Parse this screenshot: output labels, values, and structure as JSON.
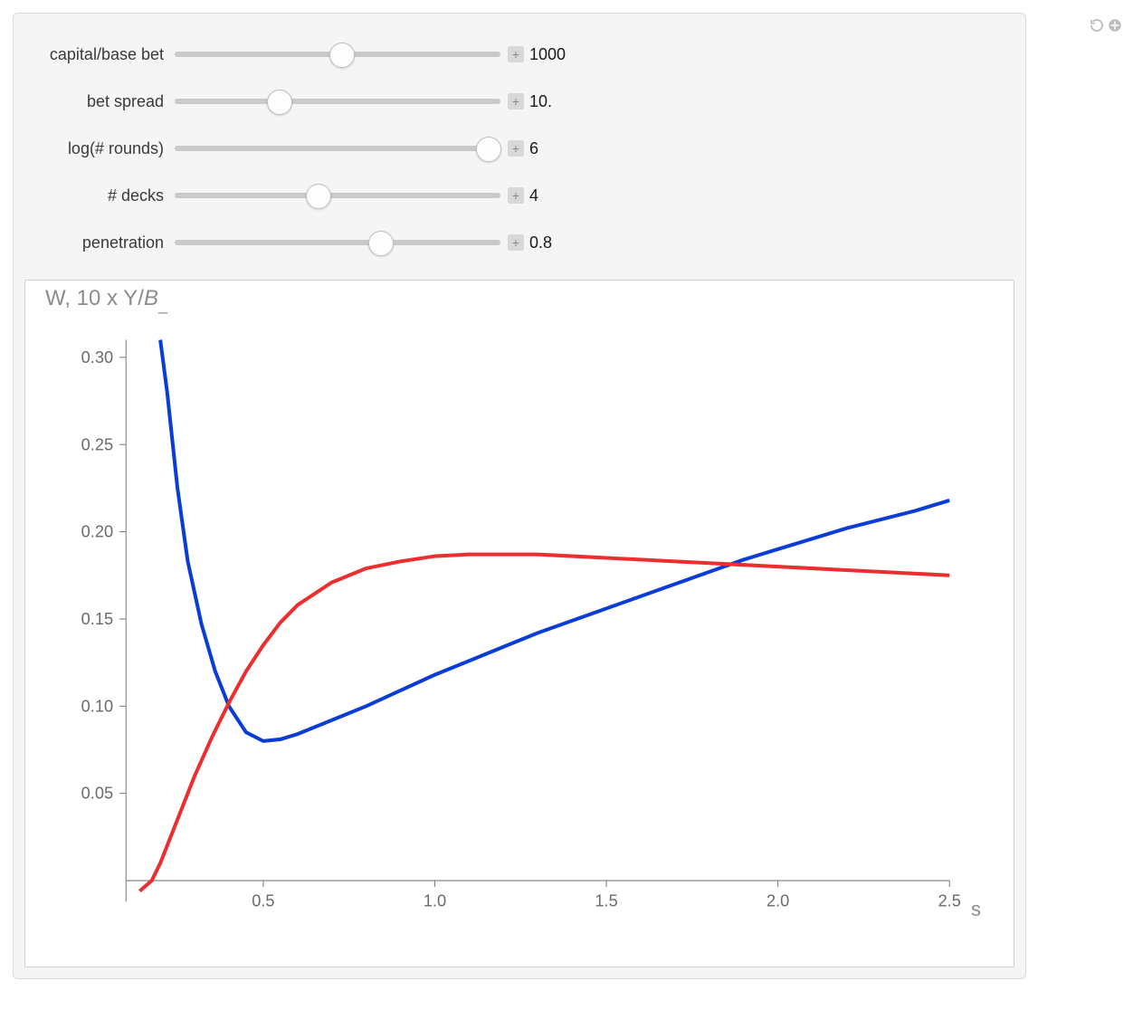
{
  "controls": [
    {
      "id": "capital",
      "label": "capital/base bet",
      "value": "1000",
      "pos": 0.51
    },
    {
      "id": "spread",
      "label": "bet spread",
      "value": "10.",
      "pos": 0.32
    },
    {
      "id": "logrounds",
      "label": "log(# rounds)",
      "value": "6",
      "pos": 0.96
    },
    {
      "id": "decks",
      "label": "# decks",
      "value": "4",
      "pos": 0.44
    },
    {
      "id": "penetration",
      "label": "penetration",
      "value": "0.8",
      "pos": 0.63
    }
  ],
  "chart_data": {
    "type": "line",
    "title": "",
    "ylabel_plain": "W, 10 x Y/B_",
    "xlabel": "s",
    "xlim": [
      0.1,
      2.5
    ],
    "ylim": [
      -0.01,
      0.31
    ],
    "xticks": [
      0.5,
      1.0,
      1.5,
      2.0,
      2.5
    ],
    "yticks": [
      0.05,
      0.1,
      0.15,
      0.2,
      0.25,
      0.3
    ],
    "series": [
      {
        "name": "W (blue)",
        "color": "#0b3dd6",
        "x": [
          0.2,
          0.22,
          0.25,
          0.28,
          0.32,
          0.36,
          0.4,
          0.45,
          0.5,
          0.55,
          0.6,
          0.7,
          0.8,
          0.9,
          1.0,
          1.1,
          1.2,
          1.3,
          1.4,
          1.5,
          1.6,
          1.7,
          1.8,
          1.9,
          2.0,
          2.1,
          2.2,
          2.3,
          2.4,
          2.5
        ],
        "values": [
          0.31,
          0.28,
          0.225,
          0.183,
          0.147,
          0.12,
          0.1,
          0.085,
          0.08,
          0.081,
          0.084,
          0.092,
          0.1,
          0.109,
          0.118,
          0.126,
          0.134,
          0.142,
          0.149,
          0.156,
          0.163,
          0.17,
          0.177,
          0.184,
          0.19,
          0.196,
          0.202,
          0.207,
          0.212,
          0.218
        ]
      },
      {
        "name": "10 x Y/B_ (red)",
        "color": "#eb2f2f",
        "x": [
          0.14,
          0.175,
          0.2,
          0.25,
          0.3,
          0.35,
          0.4,
          0.45,
          0.5,
          0.55,
          0.6,
          0.7,
          0.8,
          0.9,
          1.0,
          1.1,
          1.2,
          1.3,
          1.4,
          1.5,
          1.6,
          1.7,
          1.8,
          1.9,
          2.0,
          2.1,
          2.2,
          2.3,
          2.4,
          2.5
        ],
        "values": [
          -0.006,
          0.0,
          0.01,
          0.035,
          0.06,
          0.082,
          0.102,
          0.12,
          0.135,
          0.148,
          0.158,
          0.171,
          0.179,
          0.183,
          0.186,
          0.187,
          0.187,
          0.187,
          0.186,
          0.185,
          0.184,
          0.183,
          0.182,
          0.181,
          0.18,
          0.179,
          0.178,
          0.177,
          0.176,
          0.175
        ]
      }
    ]
  },
  "expand_symbol": "+"
}
